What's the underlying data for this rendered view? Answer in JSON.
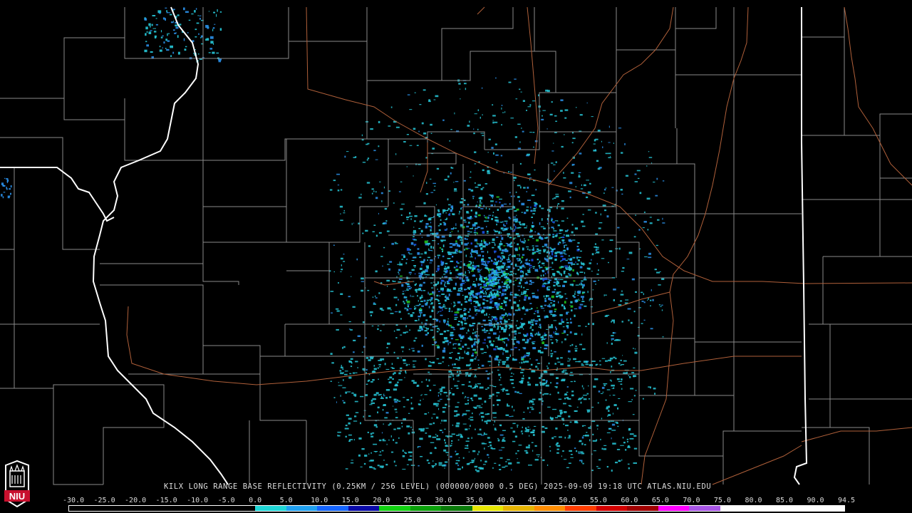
{
  "product": {
    "caption": "KILX LONG RANGE BASE REFLECTIVITY (0.25KM / 256 LEVEL) (000000/0000 0.5 DEG) 2025-09-09 19:18 UTC  ATLAS.NIU.EDU",
    "logo_text": "NIU"
  },
  "scale": {
    "labels": [
      "-30.0",
      "-25.0",
      "-20.0",
      "-15.0",
      "-10.0",
      "-5.0",
      "0.0",
      "5.0",
      "10.0",
      "15.0",
      "20.0",
      "25.0",
      "30.0",
      "35.0",
      "40.0",
      "45.0",
      "50.0",
      "55.0",
      "60.0",
      "65.0",
      "70.0",
      "75.0",
      "80.0",
      "85.0",
      "90.0",
      "94.5"
    ],
    "colors": [
      "#000000",
      "#000000",
      "#000000",
      "#000000",
      "#000000",
      "#000000",
      "#1fd6d6",
      "#1fa0f0",
      "#1464ff",
      "#0a0aa8",
      "#11d111",
      "#0aa00a",
      "#0a7a0a",
      "#e6e600",
      "#e6b400",
      "#ff8c00",
      "#ff3c00",
      "#d20000",
      "#a00000",
      "#ff00ff",
      "#a855e6",
      "#ffffff",
      "#ffffff",
      "#ffffff",
      "#ffffff"
    ]
  },
  "colors": {
    "background": "#000000",
    "county_lines": "#8a8a8a",
    "state_lines": "#ffffff",
    "roads": "#b0603a",
    "echo_light": "#27c8d8",
    "echo_medium": "#2a8fe8",
    "echo_strong": "#1a4fe0",
    "echo_green": "#20c020"
  }
}
